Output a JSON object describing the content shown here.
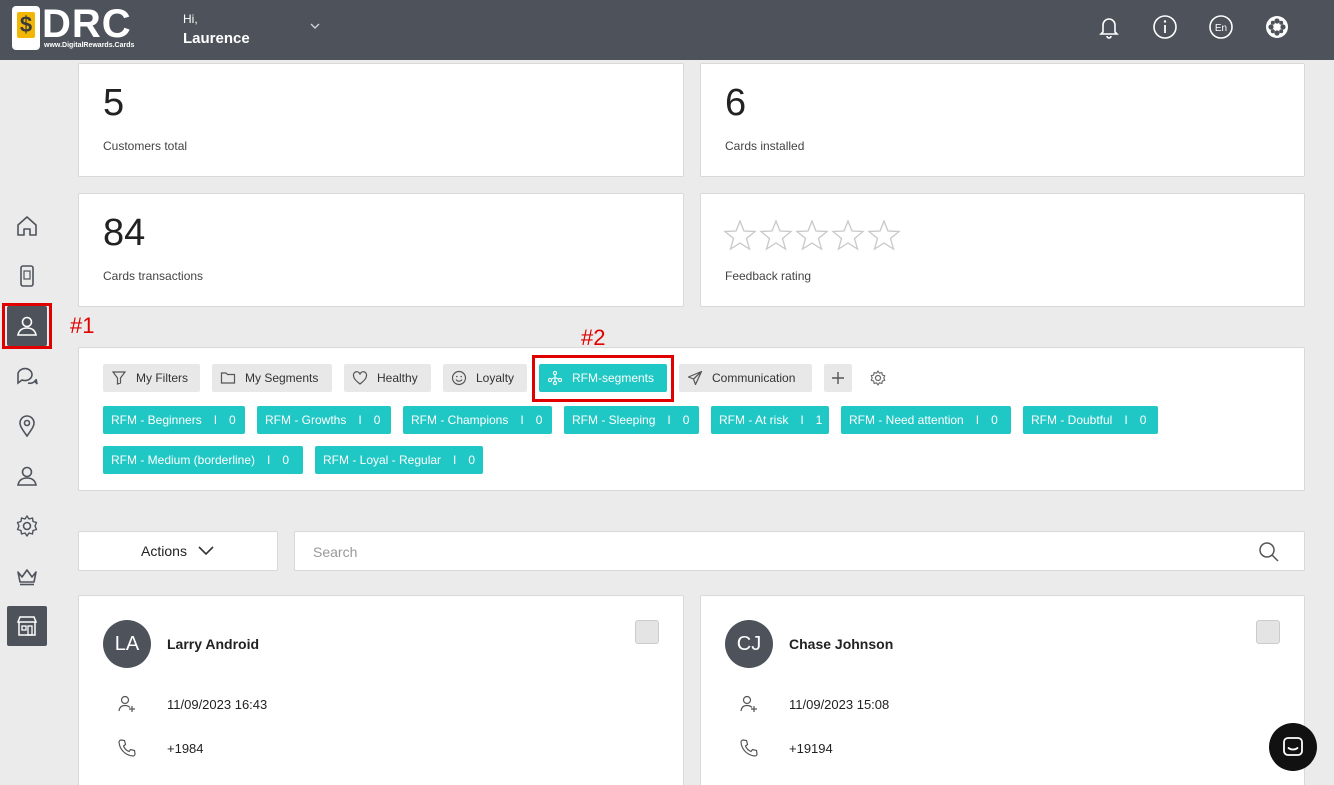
{
  "header": {
    "logo_text": "DRC",
    "logo_symbol": "$",
    "logo_url": "www.DigitalRewards.Cards",
    "greeting": "Hi,",
    "user_name": "Laurence",
    "icons": [
      "bell-icon",
      "info-icon",
      "language-icon",
      "settings-flower-icon"
    ],
    "language": "En"
  },
  "sidebar": {
    "items": [
      "home-icon",
      "mobile-card-icon",
      "customers-icon",
      "chat-icon",
      "location-icon",
      "user-icon",
      "settings-icon",
      "crown-icon",
      "store-icon"
    ],
    "active": "customers-icon"
  },
  "annotations": {
    "label_1": "#1",
    "label_2": "#2"
  },
  "stats": [
    {
      "value": "5",
      "label": "Customers total"
    },
    {
      "value": "6",
      "label": "Cards installed"
    },
    {
      "value": "84",
      "label": "Cards transactions"
    },
    {
      "label": "Feedback rating",
      "rating": 0,
      "max_rating": 5
    }
  ],
  "filter_tabs": [
    {
      "label": "My Filters",
      "icon": "filter-icon"
    },
    {
      "label": "My Segments",
      "icon": "folder-icon"
    },
    {
      "label": "Healthy",
      "icon": "heart-icon"
    },
    {
      "label": "Loyalty",
      "icon": "smile-icon"
    },
    {
      "label": "RFM-segments",
      "icon": "rfm-icon",
      "active": true
    },
    {
      "label": "Communication",
      "icon": "send-icon"
    }
  ],
  "segments": [
    {
      "label": "RFM - Beginners",
      "sep": "I",
      "count": "0"
    },
    {
      "label": "RFM - Growths",
      "sep": "I",
      "count": "0"
    },
    {
      "label": "RFM - Champions",
      "sep": "I",
      "count": "0"
    },
    {
      "label": "RFM - Sleeping",
      "sep": "I",
      "count": "0"
    },
    {
      "label": "RFM - At risk",
      "sep": "I",
      "count": "1"
    },
    {
      "label": "RFM - Need attention",
      "sep": "I",
      "count": "0"
    },
    {
      "label": "RFM - Doubtful",
      "sep": "I",
      "count": "0"
    },
    {
      "label": "RFM - Medium (borderline)",
      "sep": "I",
      "count": "0"
    },
    {
      "label": "RFM - Loyal - Regular",
      "sep": "I",
      "count": "0"
    }
  ],
  "toolbar": {
    "actions_label": "Actions",
    "search_placeholder": "Search"
  },
  "customers": [
    {
      "initials": "LA",
      "name": "Larry Android",
      "date": "11/09/2023 16:43",
      "phone": "+1984"
    },
    {
      "initials": "CJ",
      "name": "Chase Johnson",
      "date": "11/09/2023 15:08",
      "phone": "+19194"
    }
  ],
  "colors": {
    "header_bg": "#4e535b",
    "accent": "#1fc8c4",
    "highlight": "#e00000",
    "page_bg": "#ebebeb"
  }
}
